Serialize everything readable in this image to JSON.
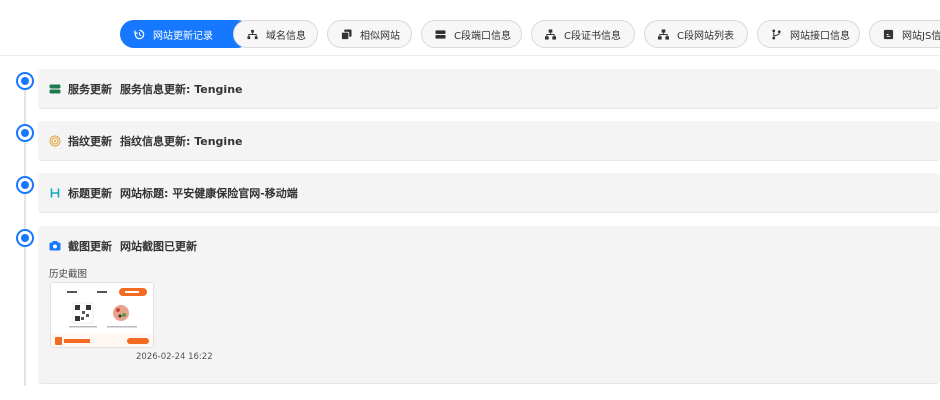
{
  "tabs": [
    {
      "label": "网站更新记录",
      "icon": "history-icon",
      "active": true
    },
    {
      "label": "域名信息",
      "icon": "sitemap-icon",
      "active": false
    },
    {
      "label": "相似网站",
      "icon": "copy-icon",
      "active": false
    },
    {
      "label": "C段端口信息",
      "icon": "server-icon",
      "active": false
    },
    {
      "label": "C段证书信息",
      "icon": "network-icon",
      "active": false
    },
    {
      "label": "C段网站列表",
      "icon": "network-icon",
      "active": false
    },
    {
      "label": "网站接口信息",
      "icon": "branch-icon",
      "active": false
    },
    {
      "label": "网站JS信息",
      "icon": "js-file-icon",
      "active": false
    }
  ],
  "timeline": [
    {
      "type": "服务更新",
      "text": "服务信息更新: Tengine",
      "icon": "server-icon",
      "icon_color": "#1e7a4c"
    },
    {
      "type": "指纹更新",
      "text": "指纹信息更新: Tengine",
      "icon": "fingerprint-icon",
      "icon_color": "#e6a23c"
    },
    {
      "type": "标题更新",
      "text": "网站标题: 平安健康保险官网-移动端",
      "icon": "heading-icon",
      "icon_color": "#13a8c2"
    },
    {
      "type": "截图更新",
      "text": "网站截图已更新",
      "icon": "camera-icon",
      "icon_color": "#1677ff",
      "history_label": "历史截图",
      "screenshot": {
        "time": "2026-02-24 16:22",
        "brand": "平安健康保险"
      }
    }
  ],
  "colors": {
    "accent": "#1677ff",
    "card_bg": "#f4f4f5",
    "brand_orange": "#f26b21"
  }
}
